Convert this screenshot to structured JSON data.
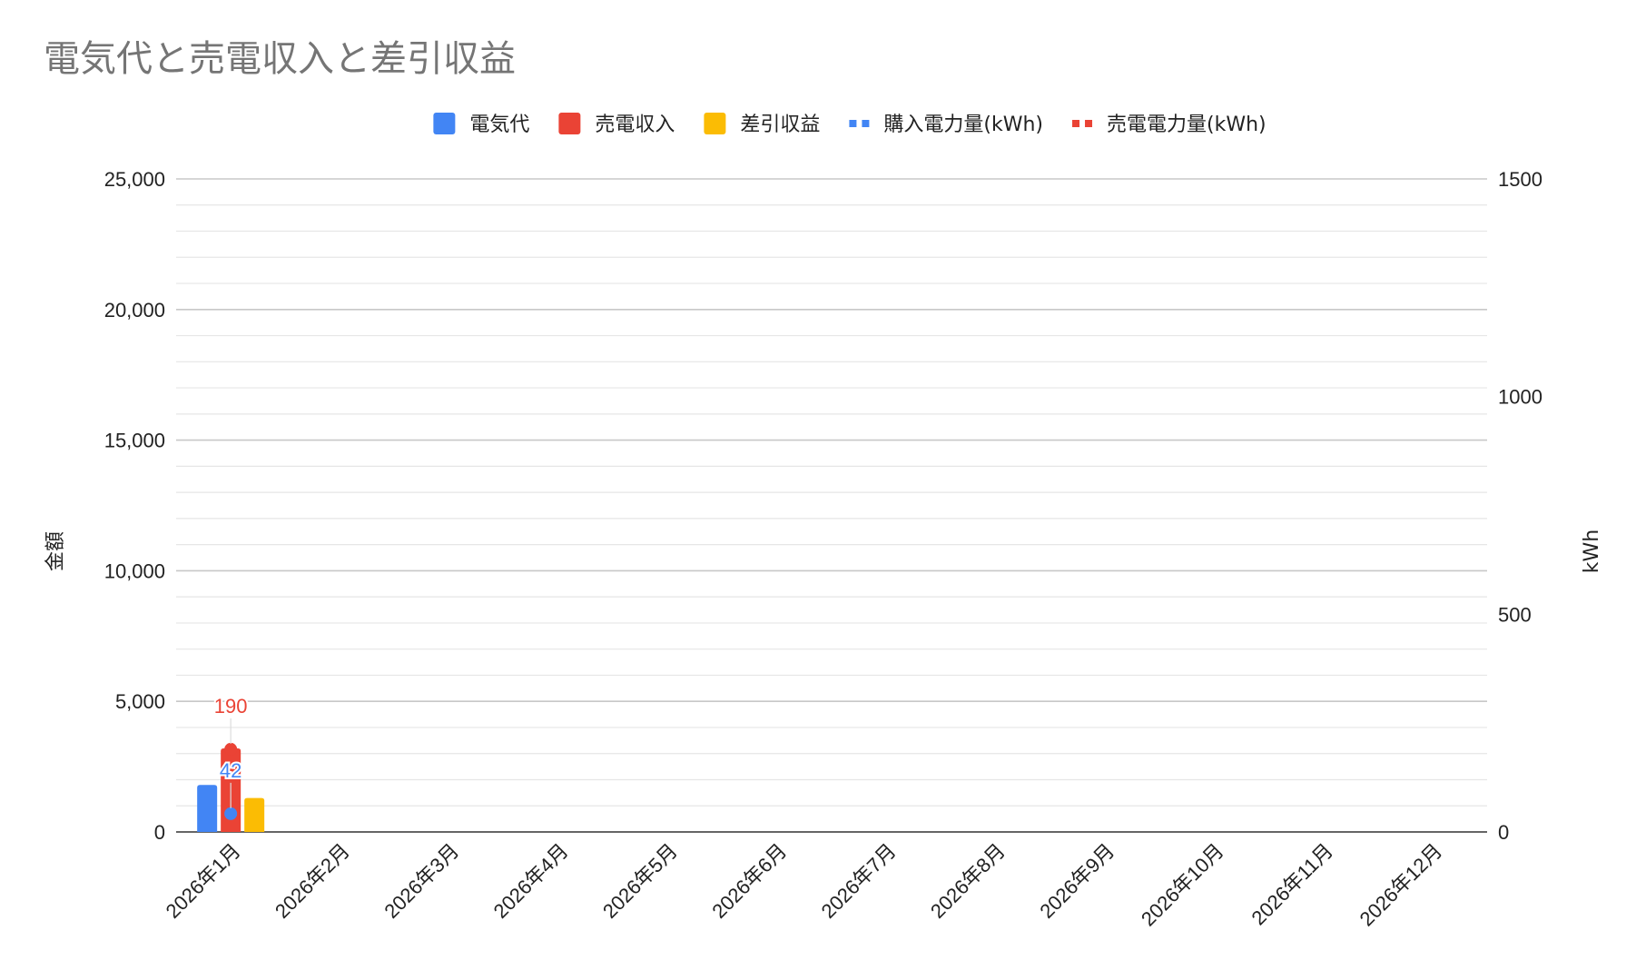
{
  "chart_data": {
    "type": "bar",
    "title": "電気代と売電収入と差引収益",
    "categories": [
      "2026年1月",
      "2026年2月",
      "2026年3月",
      "2026年4月",
      "2026年5月",
      "2026年6月",
      "2026年7月",
      "2026年8月",
      "2026年9月",
      "2026年10月",
      "2026年11月",
      "2026年12月"
    ],
    "ylabel_left": "金額",
    "ylabel_right": "kWh",
    "ylim_left": [
      0,
      25000
    ],
    "ylim_right": [
      0,
      1500
    ],
    "yticks_left": [
      "0",
      "5,000",
      "10,000",
      "15,000",
      "20,000",
      "25,000"
    ],
    "yticks_right": [
      "0",
      "500",
      "1000",
      "1500"
    ],
    "legend_position": "top",
    "grid": true,
    "series": [
      {
        "name": "電気代",
        "kind": "bar",
        "axis": "left",
        "color": "#4285f4",
        "values": [
          1800,
          null,
          null,
          null,
          null,
          null,
          null,
          null,
          null,
          null,
          null,
          null
        ]
      },
      {
        "name": "売電収入",
        "kind": "bar",
        "axis": "left",
        "color": "#ea4335",
        "values": [
          3200,
          null,
          null,
          null,
          null,
          null,
          null,
          null,
          null,
          null,
          null,
          null
        ]
      },
      {
        "name": "差引収益",
        "kind": "bar",
        "axis": "left",
        "color": "#fbbc04",
        "values": [
          1300,
          null,
          null,
          null,
          null,
          null,
          null,
          null,
          null,
          null,
          null,
          null
        ]
      },
      {
        "name": "購入電力量(kWh)",
        "kind": "line",
        "axis": "right",
        "color": "#4285f4",
        "values": [
          42,
          null,
          null,
          null,
          null,
          null,
          null,
          null,
          null,
          null,
          null,
          null
        ],
        "labels": [
          "42"
        ]
      },
      {
        "name": "売電電力量(kWh)",
        "kind": "line",
        "axis": "right",
        "color": "#ea4335",
        "values": [
          190,
          null,
          null,
          null,
          null,
          null,
          null,
          null,
          null,
          null,
          null,
          null
        ],
        "labels": [
          "190"
        ]
      }
    ]
  }
}
